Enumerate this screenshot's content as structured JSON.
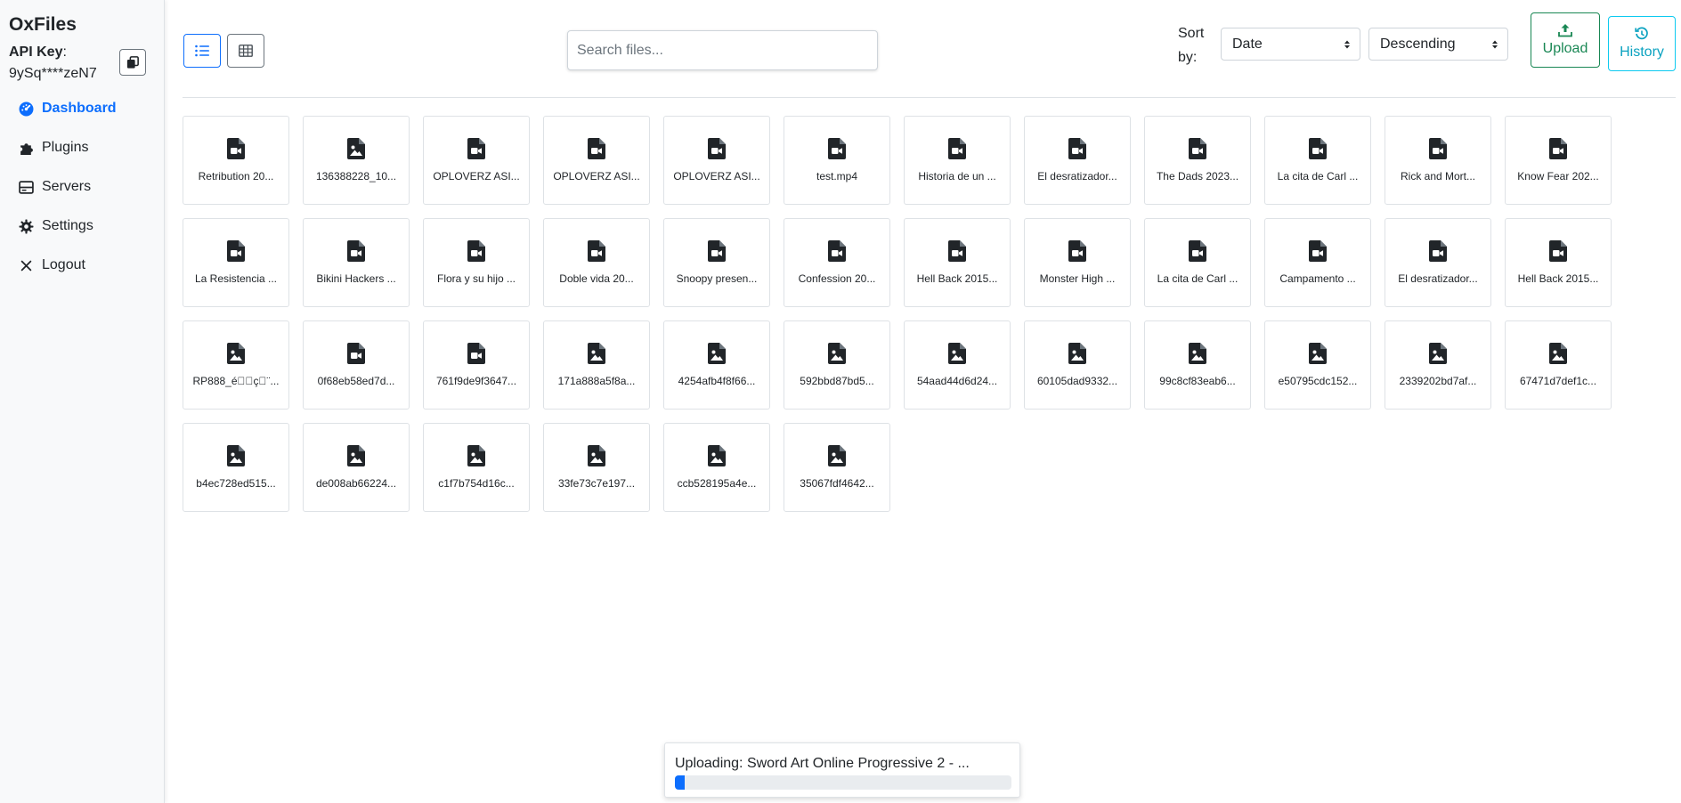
{
  "sidebar": {
    "brand": "OxFiles",
    "api_key_label": "API Key",
    "api_key_colon": ":",
    "api_key_value": "9ySq****zeN7",
    "copy_icon": "copy-icon",
    "items": [
      {
        "label": "Dashboard",
        "icon": "dashboard-icon",
        "active": true
      },
      {
        "label": "Plugins",
        "icon": "puzzle-icon",
        "active": false
      },
      {
        "label": "Servers",
        "icon": "server-icon",
        "active": false
      },
      {
        "label": "Settings",
        "icon": "gear-icon",
        "active": false
      },
      {
        "label": "Logout",
        "icon": "close-icon",
        "active": false
      }
    ]
  },
  "toolbar": {
    "list_view_icon": "list-icon",
    "grid_view_icon": "table-icon",
    "search_placeholder": "Search files...",
    "sort_label_line1": "Sort",
    "sort_label_line2": "by:",
    "sort_field": "Date",
    "sort_order": "Descending",
    "upload_label": "Upload",
    "history_label": "History"
  },
  "files": [
    {
      "name": "Retribution 20...",
      "type": "video"
    },
    {
      "name": "136388228_10...",
      "type": "image"
    },
    {
      "name": "OPLOVERZ ASI...",
      "type": "video"
    },
    {
      "name": "OPLOVERZ ASI...",
      "type": "video"
    },
    {
      "name": "OPLOVERZ ASI...",
      "type": "video"
    },
    {
      "name": "test.mp4",
      "type": "video"
    },
    {
      "name": "Historia de un ...",
      "type": "video"
    },
    {
      "name": "El desratizador...",
      "type": "video"
    },
    {
      "name": "The Dads 2023...",
      "type": "video"
    },
    {
      "name": "La cita de Carl ...",
      "type": "video"
    },
    {
      "name": "Rick and Mort...",
      "type": "video"
    },
    {
      "name": "Know Fear 202...",
      "type": "video"
    },
    {
      "name": "La Resistencia ...",
      "type": "video"
    },
    {
      "name": "Bikini Hackers ...",
      "type": "video"
    },
    {
      "name": "Flora y su hijo ...",
      "type": "video"
    },
    {
      "name": "Doble vida 20...",
      "type": "video"
    },
    {
      "name": "Snoopy presen...",
      "type": "video"
    },
    {
      "name": "Confession 20...",
      "type": "video"
    },
    {
      "name": "Hell Back 2015...",
      "type": "video"
    },
    {
      "name": "Monster High ...",
      "type": "video"
    },
    {
      "name": "La cita de Carl ...",
      "type": "video"
    },
    {
      "name": "Campamento ...",
      "type": "video"
    },
    {
      "name": "El desratizador...",
      "type": "video"
    },
    {
      "name": "Hell Back 2015...",
      "type": "video"
    },
    {
      "name": "RP888_é\u0000\u0000ç\u0000¨...",
      "type": "image"
    },
    {
      "name": "0f68eb58ed7d...",
      "type": "video"
    },
    {
      "name": "761f9de9f3647...",
      "type": "video"
    },
    {
      "name": "171a888a5f8a...",
      "type": "image"
    },
    {
      "name": "4254afb4f8f66...",
      "type": "image"
    },
    {
      "name": "592bbd87bd5...",
      "type": "image"
    },
    {
      "name": "54aad44d6d24...",
      "type": "image"
    },
    {
      "name": "60105dad9332...",
      "type": "image"
    },
    {
      "name": "99c8cf83eab6...",
      "type": "image"
    },
    {
      "name": "e50795cdc152...",
      "type": "image"
    },
    {
      "name": "2339202bd7af...",
      "type": "image"
    },
    {
      "name": "67471d7def1c...",
      "type": "image"
    },
    {
      "name": "b4ec728ed515...",
      "type": "image"
    },
    {
      "name": "de008ab66224...",
      "type": "image"
    },
    {
      "name": "c1f7b754d16c...",
      "type": "image"
    },
    {
      "name": "33fe73c7e197...",
      "type": "image"
    },
    {
      "name": "ccb528195a4e...",
      "type": "image"
    },
    {
      "name": "35067fdf4642...",
      "type": "image"
    }
  ],
  "upload_toast": {
    "text": "Uploading: Sword Art Online Progressive 2 - ...",
    "progress_percent": 3
  },
  "colors": {
    "primary": "#0d6efd",
    "success": "#198754",
    "info": "#0dcaf0",
    "icon_dark": "#212529"
  }
}
